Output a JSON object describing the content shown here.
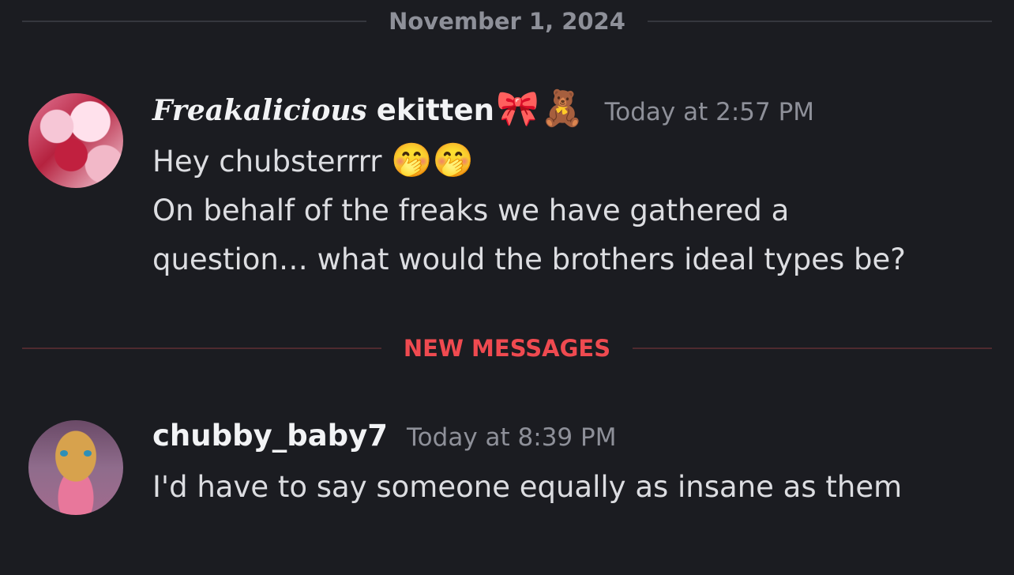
{
  "date_divider": "November 1, 2024",
  "new_messages_divider": "NEW MESSAGES",
  "messages": [
    {
      "username_styled": "Freakalicious",
      "username_plain": "ekitten",
      "username_emojis": [
        "🎀",
        "🧸"
      ],
      "timestamp": "Today at 2:57 PM",
      "lines": [
        "Hey chubsterrrr",
        "On behalf of the freaks we have gathered a",
        "question… what would the brothers ideal types be?"
      ],
      "line1_emojis": "🤭🤭"
    },
    {
      "username": "chubby_baby7",
      "timestamp": "Today at 8:39 PM",
      "lines": [
        "I'd have to say someone equally as insane as them"
      ]
    }
  ]
}
